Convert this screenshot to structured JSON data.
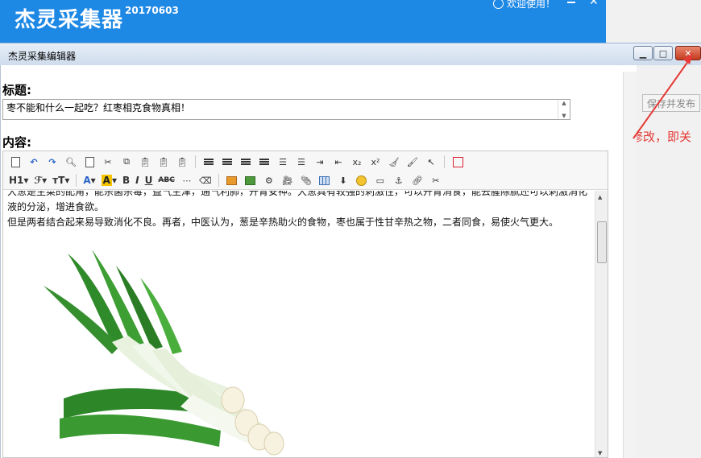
{
  "background_app": {
    "title": "杰灵采集器",
    "version": "20170603",
    "welcome": "欢迎使用！",
    "publish_button": "保存并发布",
    "annotation": "无需修改，即关闭"
  },
  "editor_window": {
    "title": "杰灵采集编辑器",
    "title_label": "标题:",
    "title_value": "枣不能和什么一起吃？红枣相克食物真相！",
    "content_label": "内容:",
    "paragraph1": "大葱是主菜的配角，能杀菌杀毒，益气生津，通气利肺，开胃安神。大葱具有较强的刺激性，可以开胃消食，能去腥除腻还可以刺激消化液的分泌，增进食欲。",
    "paragraph2": "但是两者结合起来易导致消化不良。再者，中医认为，葱是辛热助火的食物，枣也属于性甘辛热之物，二者同食，易使火气更大。",
    "toolbar": {
      "h1": "H1",
      "font_family": "ℱ",
      "font_size": "тT",
      "font_color": "A",
      "bg_color": "A",
      "bold": "B",
      "italic": "I",
      "underline": "U",
      "strikethrough": "ABC"
    },
    "colors": {
      "accent": "#1e88e5",
      "annotation": "#e53935",
      "close": "#c33a1f"
    }
  }
}
